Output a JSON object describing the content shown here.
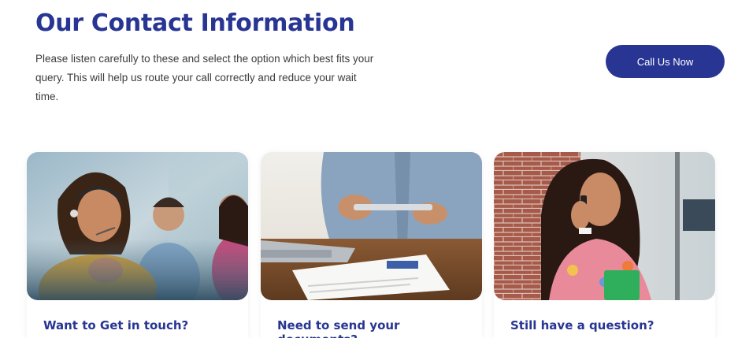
{
  "header": {
    "title": "Our Contact Information",
    "description": "Please listen carefully to these and select the option which best fits your query. This will help us route your call correctly and reduce your wait time.",
    "cta_label": "Call Us Now"
  },
  "cards": [
    {
      "label": "Want to Get in touch?",
      "image": "call-center-agent-photo"
    },
    {
      "label": "Need to send your documents?",
      "image": "document-handover-photo"
    },
    {
      "label": "Still have a question?",
      "image": "woman-on-phone-photo"
    }
  ],
  "colors": {
    "brand": "#283593",
    "text": "#3b3b3b",
    "background": "#ffffff"
  }
}
